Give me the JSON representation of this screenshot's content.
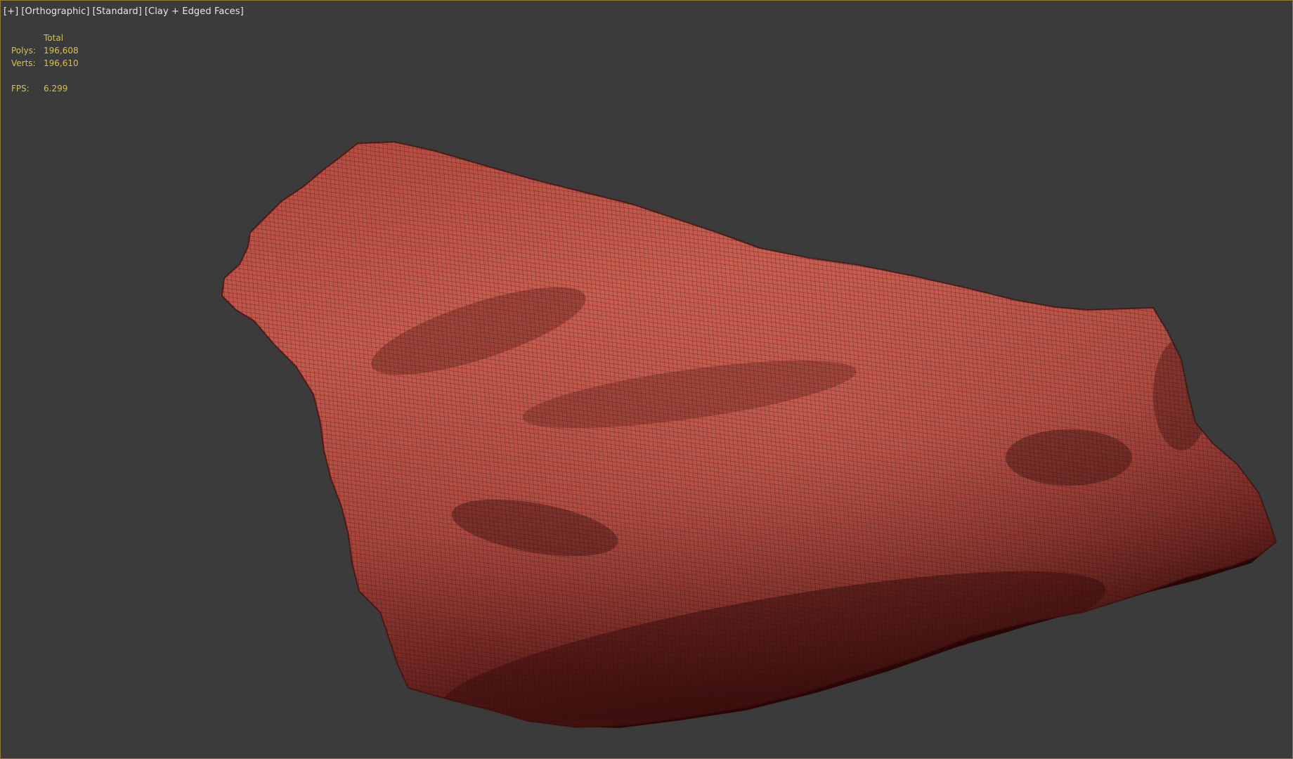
{
  "viewport": {
    "labels": {
      "plus": "[+]",
      "projection": "[Orthographic]",
      "shading": "[Standard]",
      "display_mode": "[Clay + Edged Faces]"
    },
    "stats": {
      "header": "Total",
      "polys_label": "Polys:",
      "polys_value": "196,608",
      "verts_label": "Verts:",
      "verts_value": "196,610",
      "fps_label": "FPS:",
      "fps_value": "6.299"
    }
  },
  "colors": {
    "background": "#3b3b3b",
    "border_active": "#8d7a2e",
    "stats_text": "#d9c04a",
    "label_text": "#e6e6e6",
    "mesh_light": "#c95a4c",
    "mesh_mid": "#9a3a33",
    "mesh_dark": "#3a0e0c",
    "wire": "#2a0807"
  },
  "scene": {
    "object_icon": "rock-mesh-icon"
  }
}
